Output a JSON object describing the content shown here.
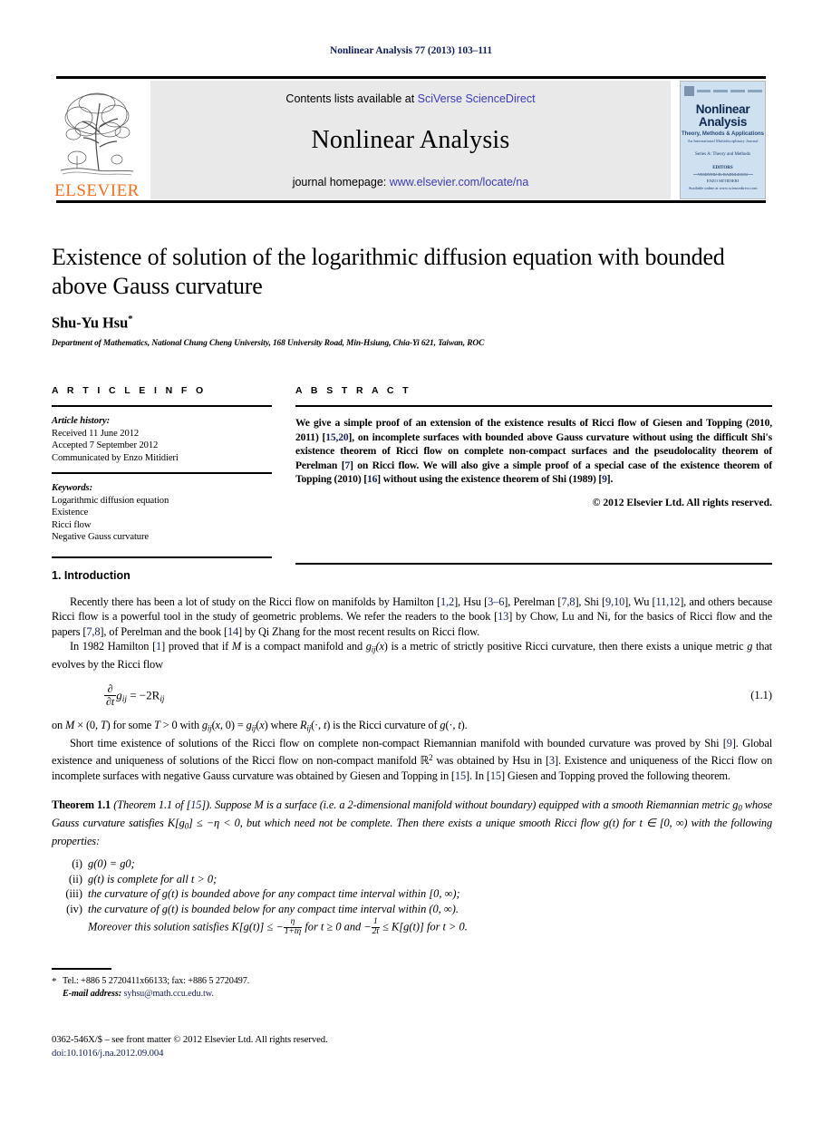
{
  "running_head": "Nonlinear Analysis 77 (2013) 103–111",
  "masthead": {
    "contents_prefix": "Contents lists available at ",
    "contents_link": "SciVerse ScienceDirect",
    "journal_name": "Nonlinear Analysis",
    "homepage_prefix": "journal homepage: ",
    "homepage_link": "www.elsevier.com/locate/na",
    "publisher": "ELSEVIER",
    "cover": {
      "title_line1": "Nonlinear",
      "title_line2": "Analysis",
      "subtitle1": "Theory, Methods & Applications",
      "subtitle2": "An International Multidisciplinary Journal",
      "subtitle3": "Series A: Theory and Methods",
      "editors_label": "EDITORS",
      "editor1": "VICENTIU D. RADULESCU",
      "editor2": "ENZO MITIDIERI",
      "foot": "Available online at www.sciencedirect.com"
    }
  },
  "article": {
    "title": "Existence of solution of the logarithmic diffusion equation with bounded above Gauss curvature",
    "author": "Shu-Yu Hsu",
    "author_marker": "*",
    "affiliation": "Department of Mathematics, National Chung Cheng University, 168 University Road, Min-Hsiung, Chia-Yi 621, Taiwan, ROC"
  },
  "info": {
    "heading": "A R T I C L E   I N F O",
    "history_label": "Article history:",
    "history": [
      "Received 11 June 2012",
      "Accepted 7 September 2012",
      "Communicated by Enzo Mitidieri"
    ],
    "keywords_label": "Keywords:",
    "keywords": [
      "Logarithmic diffusion equation",
      "Existence",
      "Ricci flow",
      "Negative Gauss curvature"
    ]
  },
  "abstract": {
    "heading": "A B S T R A C T",
    "text_parts": [
      {
        "t": "We give a simple proof of an extension of the existence results of Ricci flow of Giesen and Topping (2010, 2011) ["
      },
      {
        "t": "15,20",
        "ref": true
      },
      {
        "t": "], on incomplete surfaces with bounded above Gauss curvature without using the difficult Shi's existence theorem of Ricci flow on complete non-compact surfaces and the pseudolocality theorem of Perelman ["
      },
      {
        "t": "7",
        "ref": true
      },
      {
        "t": "] on Ricci flow. We will also give a simple proof of a special case of the existence theorem of Topping (2010) ["
      },
      {
        "t": "16",
        "ref": true
      },
      {
        "t": "] without using the existence theorem of Shi (1989) ["
      },
      {
        "t": "9",
        "ref": true
      },
      {
        "t": "]."
      }
    ],
    "copyright": "© 2012 Elsevier Ltd. All rights reserved."
  },
  "body": {
    "section_number_title": "1. Introduction",
    "para1_parts": [
      {
        "t": "Recently there has been a lot of study on the Ricci flow on manifolds by Hamilton ["
      },
      {
        "t": "1,2",
        "ref": true
      },
      {
        "t": "], Hsu ["
      },
      {
        "t": "3–6",
        "ref": true
      },
      {
        "t": "], Perelman ["
      },
      {
        "t": "7,8",
        "ref": true
      },
      {
        "t": "], Shi ["
      },
      {
        "t": "9,10",
        "ref": true
      },
      {
        "t": "], Wu ["
      },
      {
        "t": "11,12",
        "ref": true
      },
      {
        "t": "], and others because Ricci flow is a powerful tool in the study of geometric problems. We refer the readers to the book ["
      },
      {
        "t": "13",
        "ref": true
      },
      {
        "t": "] by Chow, Lu and Ni, for the basics of Ricci flow and the papers ["
      },
      {
        "t": "7,8",
        "ref": true
      },
      {
        "t": "], of Perelman and the book ["
      },
      {
        "t": "14",
        "ref": true
      },
      {
        "t": "] by Qi Zhang for the most recent results on Ricci flow."
      }
    ],
    "para2_parts": [
      {
        "t": "In 1982 Hamilton ["
      },
      {
        "t": "1",
        "ref": true
      },
      {
        "t": "] proved that if "
      },
      {
        "t": "M",
        "it": true
      },
      {
        "t": " is a compact manifold and "
      },
      {
        "t": "g",
        "it": true
      },
      {
        "t": "ij",
        "sub": true
      },
      {
        "t": "(",
        "it": true
      },
      {
        "t": "x",
        "it": true
      },
      {
        "t": ") is a metric of strictly positive Ricci curvature, then there exists a unique metric "
      },
      {
        "t": "g",
        "it": true
      },
      {
        "t": " that evolves by the Ricci flow"
      }
    ],
    "equation_number": "(1.1)",
    "equation": {
      "frac_num": "∂",
      "frac_den": "∂t",
      "lhs_sym": "g",
      "lhs_sub": "ij",
      "rhs": "= −2R",
      "rhs_sub": "ij"
    },
    "para3_parts": [
      {
        "t": "on "
      },
      {
        "t": "M",
        "it": true
      },
      {
        "t": " × (0, "
      },
      {
        "t": "T",
        "it": true
      },
      {
        "t": ") for some "
      },
      {
        "t": "T",
        "it": true
      },
      {
        "t": " > 0 with "
      },
      {
        "t": "g",
        "it": true
      },
      {
        "t": "ij",
        "sub": true
      },
      {
        "t": "("
      },
      {
        "t": "x",
        "it": true
      },
      {
        "t": ", 0) = "
      },
      {
        "t": "g",
        "it": true
      },
      {
        "t": "ij",
        "sub": true
      },
      {
        "t": "("
      },
      {
        "t": "x",
        "it": true
      },
      {
        "t": ") where "
      },
      {
        "t": "R",
        "it": true
      },
      {
        "t": "ij",
        "sub": true
      },
      {
        "t": "(·, "
      },
      {
        "t": "t",
        "it": true
      },
      {
        "t": ") is the Ricci curvature of "
      },
      {
        "t": "g",
        "it": true
      },
      {
        "t": "(·, "
      },
      {
        "t": "t",
        "it": true
      },
      {
        "t": ")."
      }
    ],
    "para4_parts": [
      {
        "t": "Short time existence of solutions of the Ricci flow on complete non-compact Riemannian manifold with bounded curvature was proved by Shi ["
      },
      {
        "t": "9",
        "ref": true
      },
      {
        "t": "]. Global existence and uniqueness of solutions of the Ricci flow on non-compact manifold ℝ"
      },
      {
        "t": "2",
        "sup": true
      },
      {
        "t": " was obtained by Hsu in ["
      },
      {
        "t": "3",
        "ref": true
      },
      {
        "t": "]. Existence and uniqueness of the Ricci flow on incomplete surfaces with negative Gauss curvature was obtained by Giesen and Topping in ["
      },
      {
        "t": "15",
        "ref": true
      },
      {
        "t": "]. In ["
      },
      {
        "t": "15",
        "ref": true
      },
      {
        "t": "] Giesen and Topping proved the following theorem."
      }
    ]
  },
  "theorem": {
    "name": "Theorem 1.1",
    "parts": [
      {
        "t": "(Theorem 1.1 of ["
      },
      {
        "t": "15",
        "ref": true
      },
      {
        "t": "]). Suppose M is a surface (i.e. a 2-dimensional manifold without boundary) equipped with a smooth Riemannian metric g"
      },
      {
        "t": "0",
        "sub": true
      },
      {
        "t": " whose Gauss curvature satisfies K[g"
      },
      {
        "t": "0",
        "sub": true
      },
      {
        "t": "] ≤ −η < 0, but which need not be complete. Then there exists a unique smooth Ricci flow g(t) for t ∈ [0, ∞) with the following properties:"
      }
    ],
    "items": [
      {
        "mark": "(i)",
        "text": "g(0) = g0;"
      },
      {
        "mark": "(ii)",
        "text": "g(t) is complete for all t > 0;"
      },
      {
        "mark": "(iii)",
        "text": "the curvature of g(t) is bounded above for any compact time interval within [0, ∞);"
      },
      {
        "mark": "(iv)",
        "text": "the curvature of g(t) is bounded below for any compact time interval within (0, ∞)."
      }
    ],
    "moreover": {
      "lead": "Moreover this solution satisfies K[g(t)] ≤ −",
      "frac1_num": "η",
      "frac1_den": "1+tη",
      "mid": " for t ≥ 0 and −",
      "frac2_num": "1",
      "frac2_den": "2t",
      "tail": " ≤ K[g(t)] for t > 0."
    }
  },
  "footnotes": {
    "tel": "Tel.: +886 5 2720411x66133; fax: +886 5 2720497.",
    "email_label": "E-mail address:",
    "email": "syhsu@math.ccu.edu.tw.",
    "issn_line": "0362-546X/$ – see front matter © 2012 Elsevier Ltd. All rights reserved.",
    "doi": "doi:10.1016/j.na.2012.09.004"
  }
}
